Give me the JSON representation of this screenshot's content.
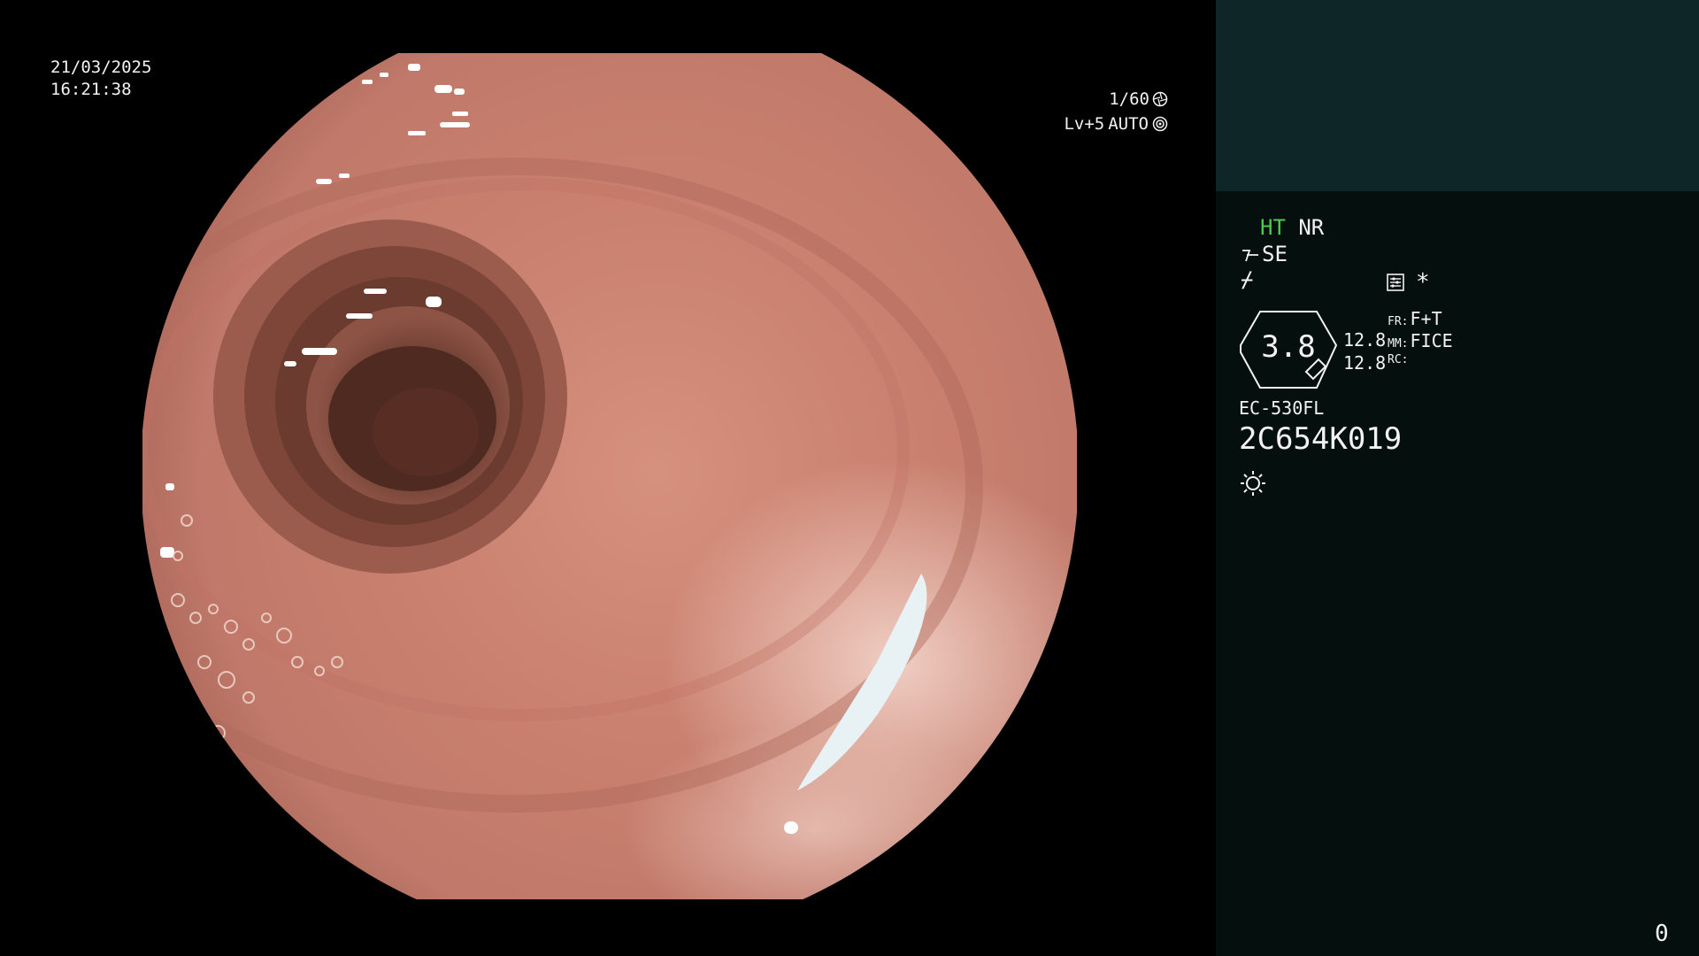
{
  "osd": {
    "date": "21/03/2025",
    "time": "16:21:38",
    "shutter": "1/60",
    "level": "Lv+5",
    "iris": "AUTO"
  },
  "panel": {
    "mode_ht": "HT",
    "mode_nr": "NR",
    "se_label": "SE",
    "curve_glyph": "⌿",
    "asterisk": "*",
    "zoom_value": "3.8",
    "value_a": "12.8",
    "value_b": "12.8",
    "fr_key": "FR:",
    "fr_value": "F+T",
    "mm_key": "MM:",
    "mm_value": "FICE",
    "rc_key": "RC:",
    "rc_value": "",
    "scope_model": "EC-530FL",
    "scope_serial": "2C654K019"
  },
  "counter": "0",
  "icons": {
    "shutter": "aperture-icon",
    "iris": "iris-icon",
    "se": "signal-enhance-icon",
    "settings": "settings-list-icon",
    "light": "light-sun-icon"
  },
  "colors": {
    "panel_top": "#0e2627",
    "panel_bottom": "#050f0d",
    "ht_green": "#45d045"
  }
}
